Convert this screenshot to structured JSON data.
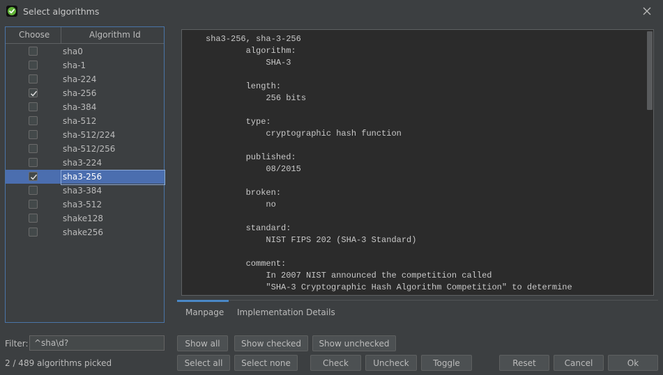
{
  "window": {
    "title": "Select algorithms"
  },
  "table": {
    "columns": [
      "Choose",
      "Algorithm Id"
    ],
    "rows": [
      {
        "name": "sha0",
        "checked": false,
        "selected": false
      },
      {
        "name": "sha-1",
        "checked": false,
        "selected": false
      },
      {
        "name": "sha-224",
        "checked": false,
        "selected": false
      },
      {
        "name": "sha-256",
        "checked": true,
        "selected": false
      },
      {
        "name": "sha-384",
        "checked": false,
        "selected": false
      },
      {
        "name": "sha-512",
        "checked": false,
        "selected": false
      },
      {
        "name": "sha-512/224",
        "checked": false,
        "selected": false
      },
      {
        "name": "sha-512/256",
        "checked": false,
        "selected": false
      },
      {
        "name": "sha3-224",
        "checked": false,
        "selected": false
      },
      {
        "name": "sha3-256",
        "checked": true,
        "selected": true
      },
      {
        "name": "sha3-384",
        "checked": false,
        "selected": false
      },
      {
        "name": "sha3-512",
        "checked": false,
        "selected": false
      },
      {
        "name": "shake128",
        "checked": false,
        "selected": false
      },
      {
        "name": "shake256",
        "checked": false,
        "selected": false
      }
    ]
  },
  "filter": {
    "label": "Filter:",
    "value": "^sha\\d?"
  },
  "status": "2 / 489 algorithms picked",
  "manpage": {
    "text": "sha3-256, sha-3-256\n        algorithm:\n            SHA-3\n\n        length:\n            256 bits\n\n        type:\n            cryptographic hash function\n\n        published:\n            08/2015\n\n        broken:\n            no\n\n        standard:\n            NIST FIPS 202 (SHA-3 Standard)\n\n        comment:\n            In 2007 NIST announced the competition called\n            \"SHA-3 Cryptographic Hash Algorithm Competition\" to determine"
  },
  "tabs": {
    "manpage": "Manpage",
    "implementation": "Implementation Details",
    "active": "manpage"
  },
  "buttons": {
    "show_all": "Show all",
    "show_checked": "Show checked",
    "show_unchecked": "Show unchecked",
    "select_all": "Select all",
    "select_none": "Select none",
    "check": "Check",
    "uncheck": "Uncheck",
    "toggle": "Toggle",
    "reset": "Reset",
    "cancel": "Cancel",
    "ok": "Ok"
  },
  "colors": {
    "background": "#3c3f41",
    "selection": "#4b6eaf",
    "tab_accent": "#4a88c7",
    "manpage_bg": "#2b2b2b"
  }
}
